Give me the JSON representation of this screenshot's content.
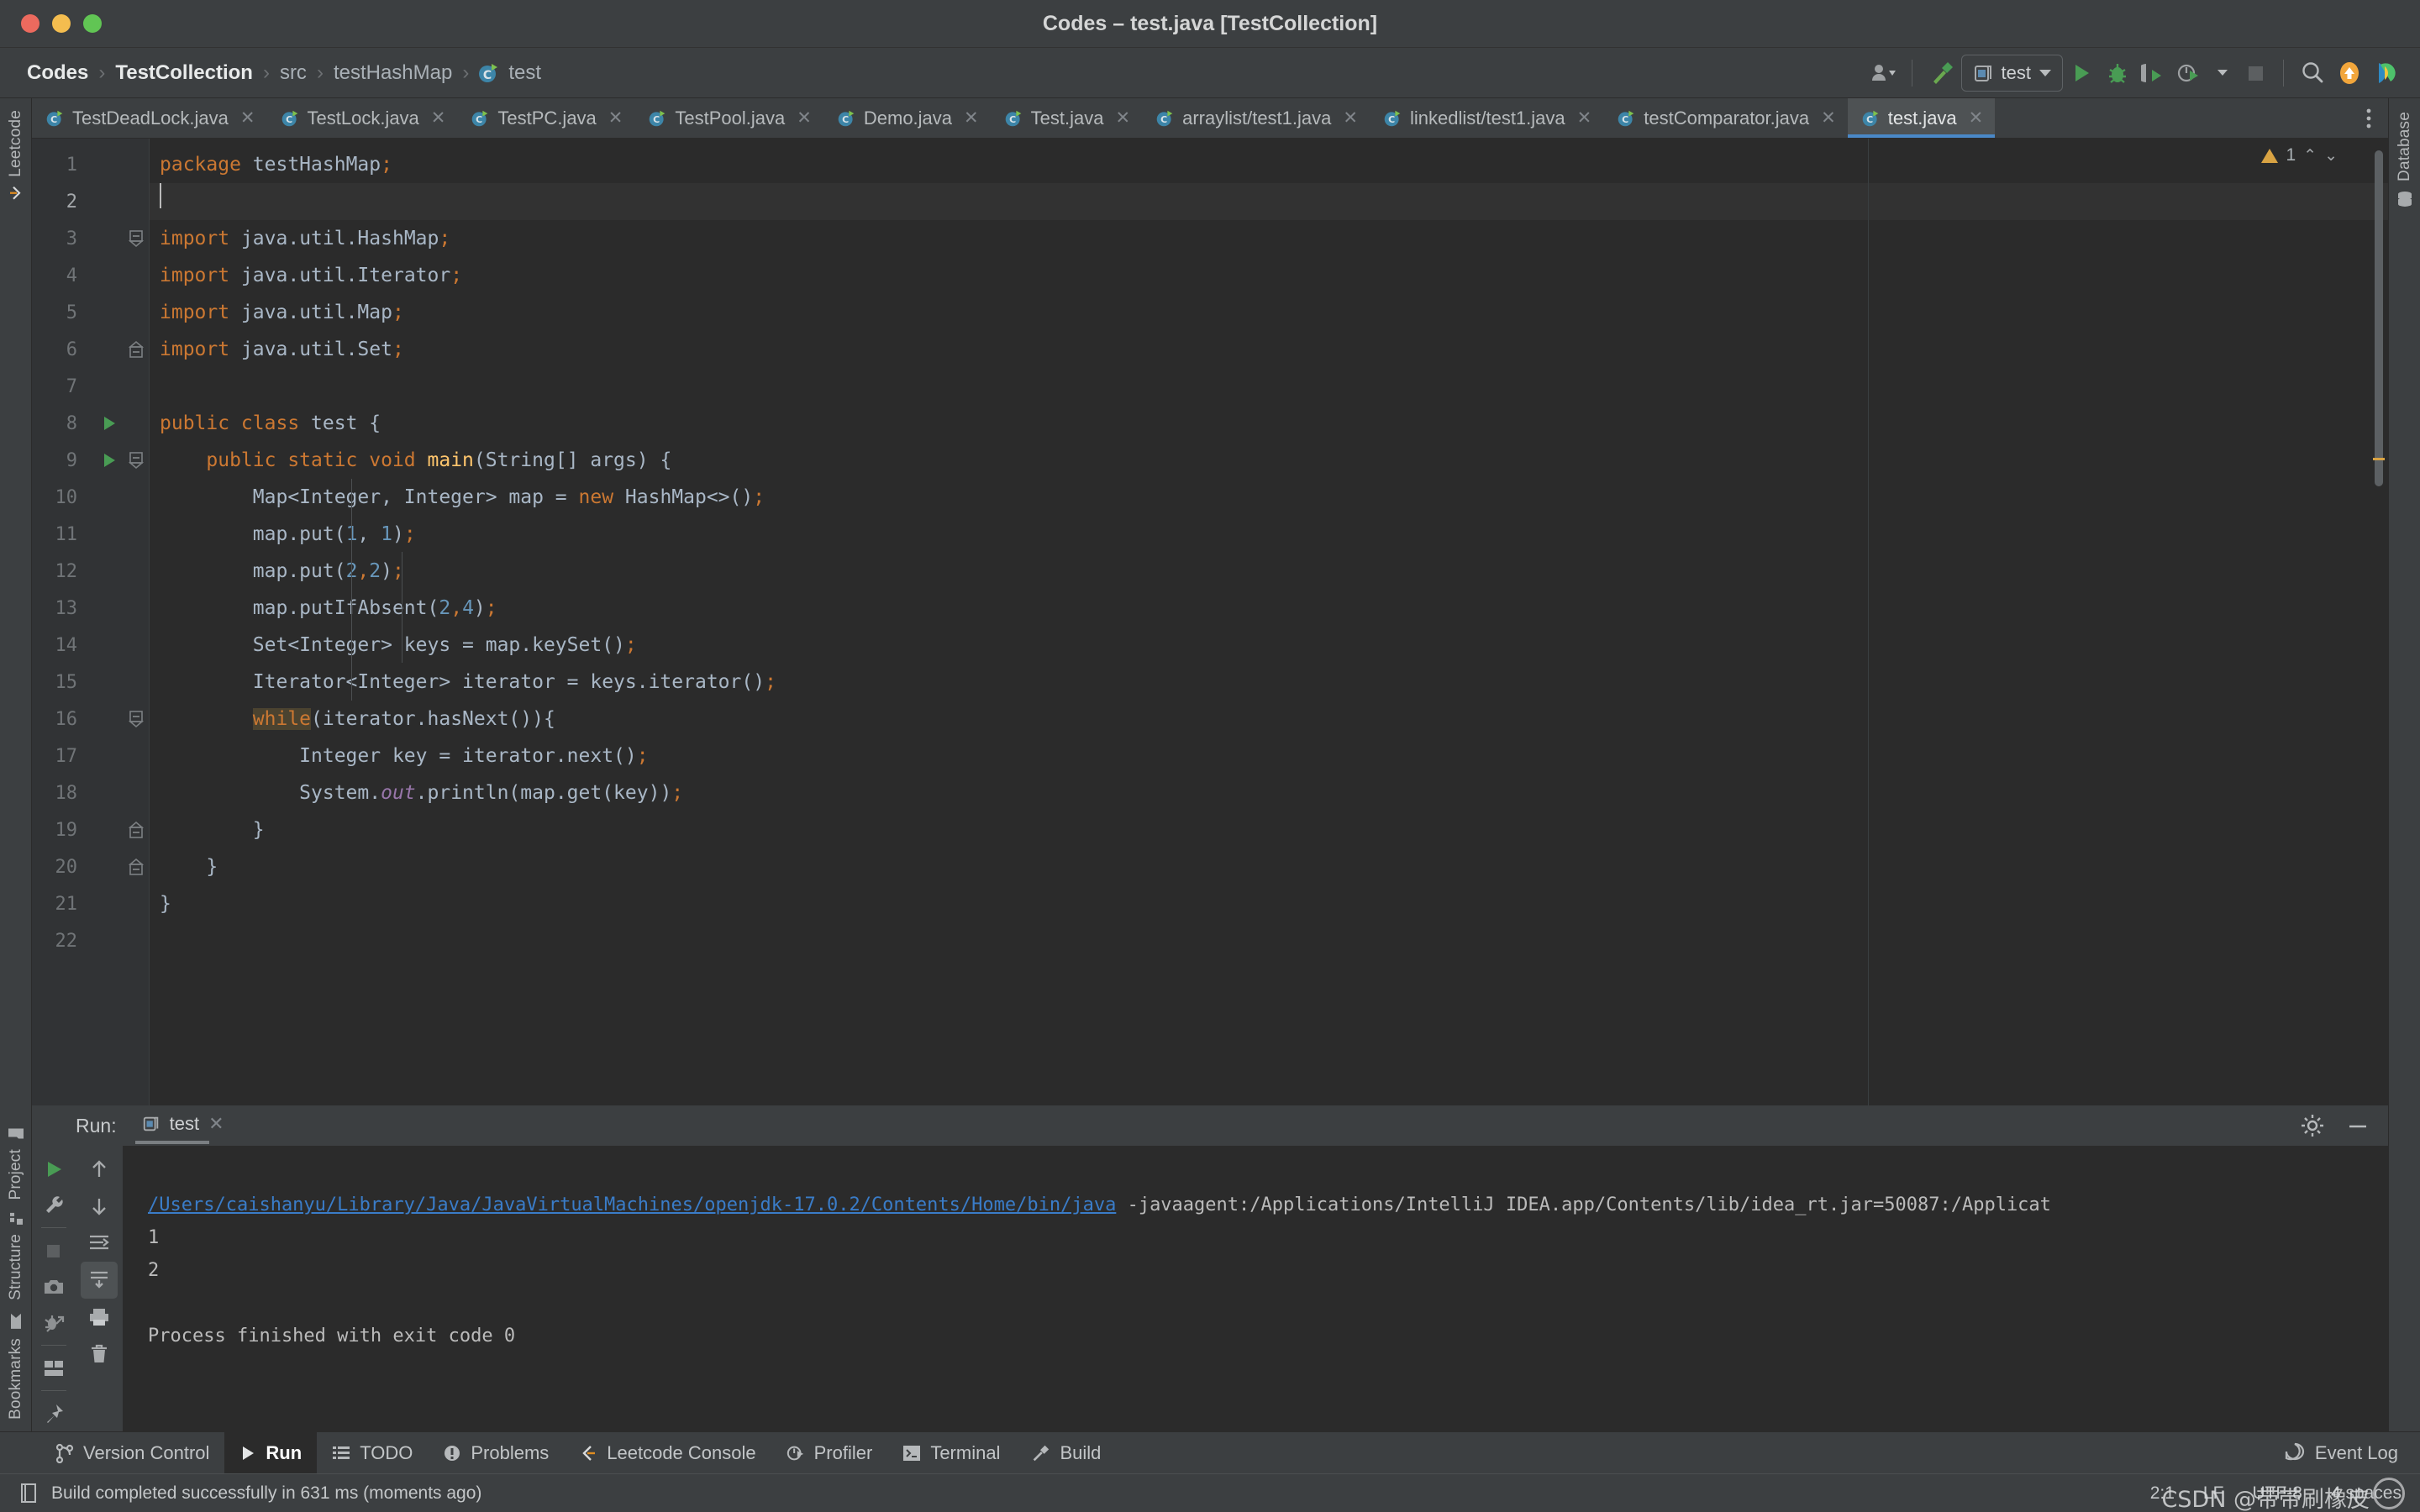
{
  "window": {
    "title": "Codes – test.java [TestCollection]",
    "traffic_lights": [
      "close-red",
      "minimize-yellow",
      "zoom-green"
    ]
  },
  "breadcrumb": {
    "items": [
      {
        "label": "Codes",
        "bold": true,
        "icon": null
      },
      {
        "label": "TestCollection",
        "bold": true,
        "icon": null
      },
      {
        "label": "src",
        "bold": false,
        "icon": null
      },
      {
        "label": "testHashMap",
        "bold": false,
        "icon": null
      },
      {
        "label": "test",
        "bold": false,
        "icon": "java-class-icon"
      }
    ],
    "separator": "›"
  },
  "toolbar": {
    "items": [
      {
        "name": "user-account-button",
        "icon": "user-icon",
        "label": ""
      },
      {
        "name": "build-button",
        "icon": "hammer-icon",
        "label": ""
      },
      {
        "name": "run-configuration-selector",
        "icon": "run-config-icon",
        "label": "test"
      },
      {
        "name": "run-button",
        "icon": "play-icon",
        "label": ""
      },
      {
        "name": "debug-button",
        "icon": "bug-icon",
        "label": ""
      },
      {
        "name": "run-with-coverage-button",
        "icon": "coverage-icon",
        "label": ""
      },
      {
        "name": "profiler-button",
        "icon": "profiler-icon",
        "label": ""
      },
      {
        "name": "stop-button",
        "icon": "stop-icon",
        "label": ""
      },
      {
        "name": "search-everywhere-button",
        "icon": "search-icon",
        "label": ""
      },
      {
        "name": "update-project-button",
        "icon": "update-arrow-icon",
        "label": ""
      },
      {
        "name": "ide-logo",
        "icon": "intellij-logo-icon",
        "label": ""
      }
    ],
    "run_config_label": "test"
  },
  "editor_tabs": {
    "tabs": [
      {
        "label": "TestDeadLock.java",
        "active": false
      },
      {
        "label": "TestLock.java",
        "active": false
      },
      {
        "label": "TestPC.java",
        "active": false
      },
      {
        "label": "TestPool.java",
        "active": false
      },
      {
        "label": "Demo.java",
        "active": false
      },
      {
        "label": "Test.java",
        "active": false
      },
      {
        "label": "arraylist/test1.java",
        "active": false
      },
      {
        "label": "linkedlist/test1.java",
        "active": false
      },
      {
        "label": "testComparator.java",
        "active": false
      },
      {
        "label": "test.java",
        "active": true
      }
    ],
    "close_glyph": "✕",
    "more_glyph": "⋮"
  },
  "left_stripe": {
    "top": [
      {
        "label": "Leetcode",
        "icon": "leetcode-icon"
      }
    ],
    "bottom": [
      {
        "label": "Project",
        "icon": "folder-icon"
      },
      {
        "label": "Structure",
        "icon": "structure-icon"
      },
      {
        "label": "Bookmarks",
        "icon": "bookmark-icon"
      }
    ]
  },
  "right_stripe": {
    "items": [
      {
        "label": "Database",
        "icon": "database-icon"
      }
    ]
  },
  "editor": {
    "inspection": {
      "warning_count": "1",
      "icon": "warning-triangle-icon",
      "up": "⌃",
      "down": "⌄"
    },
    "caret_position_line": 2,
    "lines": [
      {
        "n": "1",
        "run": false,
        "fold": "",
        "html": "<span class='kw'>package</span> <span class='txt'>testHashMap</span><span class='semi'>;</span>",
        "text": "package testHashMap;",
        "cur": false
      },
      {
        "n": "2",
        "run": false,
        "fold": "",
        "html": "",
        "text": "",
        "cur": true
      },
      {
        "n": "3",
        "run": false,
        "fold": "minus",
        "html": "<span class='kw'>import</span> <span class='txt'>java.util.HashMap</span><span class='semi'>;</span>",
        "text": "import java.util.HashMap;",
        "cur": false
      },
      {
        "n": "4",
        "run": false,
        "fold": "",
        "html": "<span class='kw'>import</span> <span class='txt'>java.util.Iterator</span><span class='semi'>;</span>",
        "text": "import java.util.Iterator;",
        "cur": false
      },
      {
        "n": "5",
        "run": false,
        "fold": "",
        "html": "<span class='kw'>import</span> <span class='txt'>java.util.Map</span><span class='semi'>;</span>",
        "text": "import java.util.Map;",
        "cur": false
      },
      {
        "n": "6",
        "run": false,
        "fold": "end",
        "html": "<span class='kw'>import</span> <span class='txt'>java.util.Set</span><span class='semi'>;</span>",
        "text": "import java.util.Set;",
        "cur": false
      },
      {
        "n": "7",
        "run": false,
        "fold": "",
        "html": "",
        "text": "",
        "cur": false
      },
      {
        "n": "8",
        "run": true,
        "fold": "",
        "html": "<span class='kw'>public class</span> <span class='txt'>test {</span>",
        "text": "public class test {",
        "cur": false
      },
      {
        "n": "9",
        "run": true,
        "fold": "minus",
        "html": "    <span class='kw'>public static void</span> <span class='mth'>main</span><span class='txt'>(String[] args) {</span>",
        "text": "    public static void main(String[] args) {",
        "cur": false
      },
      {
        "n": "10",
        "run": false,
        "fold": "",
        "html": "        <span class='txt'>Map&lt;Integer, Integer&gt; map = </span><span class='kw'>new</span><span class='txt'> HashMap&lt;&gt;()</span><span class='semi'>;</span>",
        "text": "        Map<Integer, Integer> map = new HashMap<>();",
        "cur": false
      },
      {
        "n": "11",
        "run": false,
        "fold": "",
        "html": "        <span class='txt'>map.put(</span><span class='num'>1</span><span class='txt'>, </span><span class='num'>1</span><span class='txt'>)</span><span class='semi'>;</span>",
        "text": "        map.put(1, 1);",
        "cur": false
      },
      {
        "n": "12",
        "run": false,
        "fold": "",
        "html": "        <span class='txt'>map.put(</span><span class='num'>2</span><span class='semi'>,</span><span class='num'>2</span><span class='txt'>)</span><span class='semi'>;</span>",
        "text": "        map.put(2,2);",
        "cur": false
      },
      {
        "n": "13",
        "run": false,
        "fold": "",
        "html": "        <span class='txt'>map.putIfAbsent(</span><span class='num'>2</span><span class='semi'>,</span><span class='num'>4</span><span class='txt'>)</span><span class='semi'>;</span>",
        "text": "        map.putIfAbsent(2,4);",
        "cur": false
      },
      {
        "n": "14",
        "run": false,
        "fold": "",
        "html": "        <span class='txt'>Set&lt;Integer&gt; keys = map.keySet()</span><span class='semi'>;</span>",
        "text": "        Set<Integer> keys = map.keySet();",
        "cur": false
      },
      {
        "n": "15",
        "run": false,
        "fold": "",
        "html": "        <span class='txt'>Iterator&lt;Integer&gt; iterator = keys.iterator()</span><span class='semi'>;</span>",
        "text": "        Iterator<Integer> iterator = keys.iterator();",
        "cur": false
      },
      {
        "n": "16",
        "run": false,
        "fold": "minus",
        "html": "        <span class='sel-kw'>while</span><span class='txt'>(iterator.hasNext()){</span>",
        "text": "        while(iterator.hasNext()){",
        "cur": false
      },
      {
        "n": "17",
        "run": false,
        "fold": "",
        "html": "            <span class='txt'>Integer key = iterator.next()</span><span class='semi'>;</span>",
        "text": "            Integer key = iterator.next();",
        "cur": false
      },
      {
        "n": "18",
        "run": false,
        "fold": "",
        "html": "            <span class='txt'>System.</span><span class='fld'>out</span><span class='txt'>.println(map.get(key))</span><span class='semi'>;</span>",
        "text": "            System.out.println(map.get(key));",
        "cur": false
      },
      {
        "n": "19",
        "run": false,
        "fold": "end",
        "html": "        <span class='txt'>}</span>",
        "text": "        }",
        "cur": false
      },
      {
        "n": "20",
        "run": false,
        "fold": "end",
        "html": "    <span class='txt'>}</span>",
        "text": "    }",
        "cur": false
      },
      {
        "n": "21",
        "run": false,
        "fold": "",
        "html": "<span class='txt'>}</span>",
        "text": "}",
        "cur": false
      },
      {
        "n": "22",
        "run": false,
        "fold": "",
        "html": "",
        "text": "",
        "cur": false
      }
    ]
  },
  "run_window": {
    "label": "Run:",
    "tab_label": "test",
    "tab_close": "✕",
    "settings_icon": "gear-icon",
    "minimize_icon": "minimize-icon",
    "toolbar": [
      {
        "name": "rerun-button",
        "icon": "play-icon"
      },
      {
        "name": "edit-configuration-button",
        "icon": "wrench-icon"
      },
      {
        "name": "stop-button",
        "icon": "stop-square-icon"
      },
      {
        "name": "dump-threads-button",
        "icon": "camera-icon"
      },
      {
        "name": "restore-layout-button",
        "icon": "debug-restore-icon"
      },
      {
        "name": "layout-settings-button",
        "icon": "layout-icon"
      },
      {
        "name": "pin-tab-button",
        "icon": "pin-icon"
      }
    ],
    "scroll_toolbar": [
      {
        "name": "scroll-up-button",
        "icon": "arrow-up-icon"
      },
      {
        "name": "scroll-down-button",
        "icon": "arrow-down-icon"
      },
      {
        "name": "soft-wrap-button",
        "icon": "wrap-icon"
      },
      {
        "name": "scroll-to-end-button",
        "icon": "scroll-end-icon"
      },
      {
        "name": "print-button",
        "icon": "printer-icon"
      },
      {
        "name": "clear-all-button",
        "icon": "trash-icon"
      }
    ],
    "console": {
      "command_link": "/Users/caishanyu/Library/Java/JavaVirtualMachines/openjdk-17.0.2/Contents/Home/bin/java",
      "command_args": " -javaagent:/Applications/IntelliJ IDEA.app/Contents/lib/idea_rt.jar=50087:/Applicat",
      "output_lines": [
        "1",
        "2",
        "",
        "Process finished with exit code 0"
      ]
    }
  },
  "bottom_bar": {
    "items": [
      {
        "label": "Version Control",
        "icon": "branch-icon",
        "active": false
      },
      {
        "label": "Run",
        "icon": "play-icon",
        "active": true
      },
      {
        "label": "TODO",
        "icon": "list-icon",
        "active": false
      },
      {
        "label": "Problems",
        "icon": "exclamation-circle-icon",
        "active": false
      },
      {
        "label": "Leetcode Console",
        "icon": "leetcode-icon",
        "active": false
      },
      {
        "label": "Profiler",
        "icon": "profiler-icon",
        "active": false
      },
      {
        "label": "Terminal",
        "icon": "terminal-icon",
        "active": false
      },
      {
        "label": "Build",
        "icon": "hammer-icon",
        "active": false
      }
    ],
    "event_log": {
      "label": "Event Log",
      "icon": "event-log-icon"
    }
  },
  "status_bar": {
    "message": "Build completed successfully in 631 ms (moments ago)",
    "message_icon": "book-icon",
    "caret_position": "2:1",
    "line_separator": "LF",
    "encoding": "UTF-8",
    "indent": "4 spaces",
    "watermark": "CSDN @带带刷橡皮"
  }
}
